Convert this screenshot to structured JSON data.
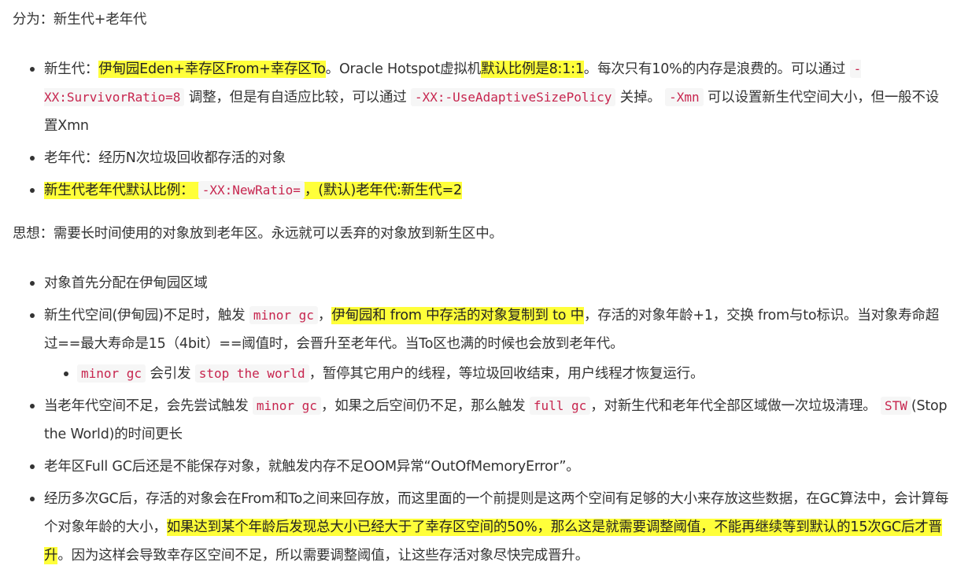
{
  "intro": "分为：新生代+老年代",
  "list1": {
    "item1": {
      "prefix": "新生代：",
      "hl1": "伊甸园Eden+幸存区From+幸存区To",
      "mid1": "。Oracle Hotspot虚拟机",
      "hl2": "默认比例是8:1:1",
      "mid2": "。每次只有10%的内存是浪费的。可以通过",
      "code1": "-XX:SurvivorRatio=8",
      "mid3": "调整，但是有自适应比较，可以通过",
      "code2": "-XX:-UseAdaptiveSizePolicy",
      "mid4": "关掉。",
      "code3": "-Xmn",
      "mid5": "可以设置新生代空间大小，但一般不设置Xmn"
    },
    "item2": "老年代：经历N次垃圾回收都存活的对象",
    "item3": {
      "hl_prefix": "新生代老年代默认比例：",
      "code": "-XX:NewRatio=",
      "hl_suffix": "，(默认)老年代:新生代=2"
    }
  },
  "thought": "思想：需要长时间使用的对象放到老年区。永远就可以丢弃的对象放到新生区中。",
  "list2": {
    "item1": "对象首先分配在伊甸园区域",
    "item2": {
      "prefix": "新生代空间(伊甸园)不足时，触发",
      "code": "minor gc",
      "sep": "，",
      "hl": "伊甸园和 from 中存活的对象复制到 to 中",
      "suffix": "，存活的对象年龄+1，交换 from与to标识。当对象寿命超过==最大寿命是15（4bit）==阈值时，会晋升至老年代。当To区也满的时候也会放到老年代。",
      "sub": {
        "code1": "minor gc",
        "mid": "会引发",
        "code2": "stop the world",
        "suffix": "，暂停其它用户的线程，等垃圾回收结束，用户线程才恢复运行。"
      }
    },
    "item3": {
      "prefix": "当老年代空间不足，会先尝试触发",
      "code1": "minor gc",
      "mid1": "，如果之后空间仍不足，那么触发",
      "code2": "full gc",
      "mid2": "，对新生代和老年代全部区域做一次垃圾清理。",
      "code3": "STW",
      "suffix": "(Stop the World)的时间更长"
    },
    "item4": "老年区Full GC后还是不能保存对象，就触发内存不足OOM异常“OutOfMemoryError”。",
    "item5": {
      "prefix": "经历多次GC后，存活的对象会在From和To之间来回存放，而这里面的一个前提则是这两个空间有足够的大小来存放这些数据，在GC算法中，会计算每个对象年龄的大小，",
      "hl": "如果达到某个年龄后发现总大小已经大于了幸存区空间的50%，那么这是就需要调整阈值，不能再继续等到默认的15次GC后才晋升",
      "suffix": "。因为这样会导致幸存区空间不足，所以需要调整阈值，让这些存活对象尽快完成晋升。"
    }
  }
}
